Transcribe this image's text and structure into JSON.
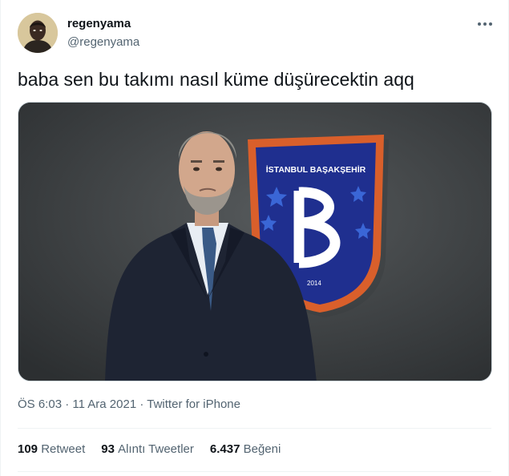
{
  "author": {
    "display_name": "regenyama",
    "handle": "@regenyama"
  },
  "tweet": {
    "text": "baba sen bu takımı nasıl küme düşürecektin aqq"
  },
  "media": {
    "badge_text": "İSTANBUL BAŞAKŞEHİR",
    "badge_year": "2014",
    "badge_colors": {
      "outer": "#d95f2b",
      "inner": "#1f2f8f",
      "star": "#3a66d6"
    }
  },
  "meta": {
    "time": "ÖS 6:03",
    "separator": "·",
    "date": "11 Ara 2021",
    "source": "Twitter for iPhone"
  },
  "stats": {
    "retweets_count": "109",
    "retweets_label": "Retweet",
    "quotes_count": "93",
    "quotes_label": "Alıntı Tweetler",
    "likes_count": "6.437",
    "likes_label": "Beğeni"
  },
  "icons": {
    "more": "more-horizontal-icon"
  }
}
